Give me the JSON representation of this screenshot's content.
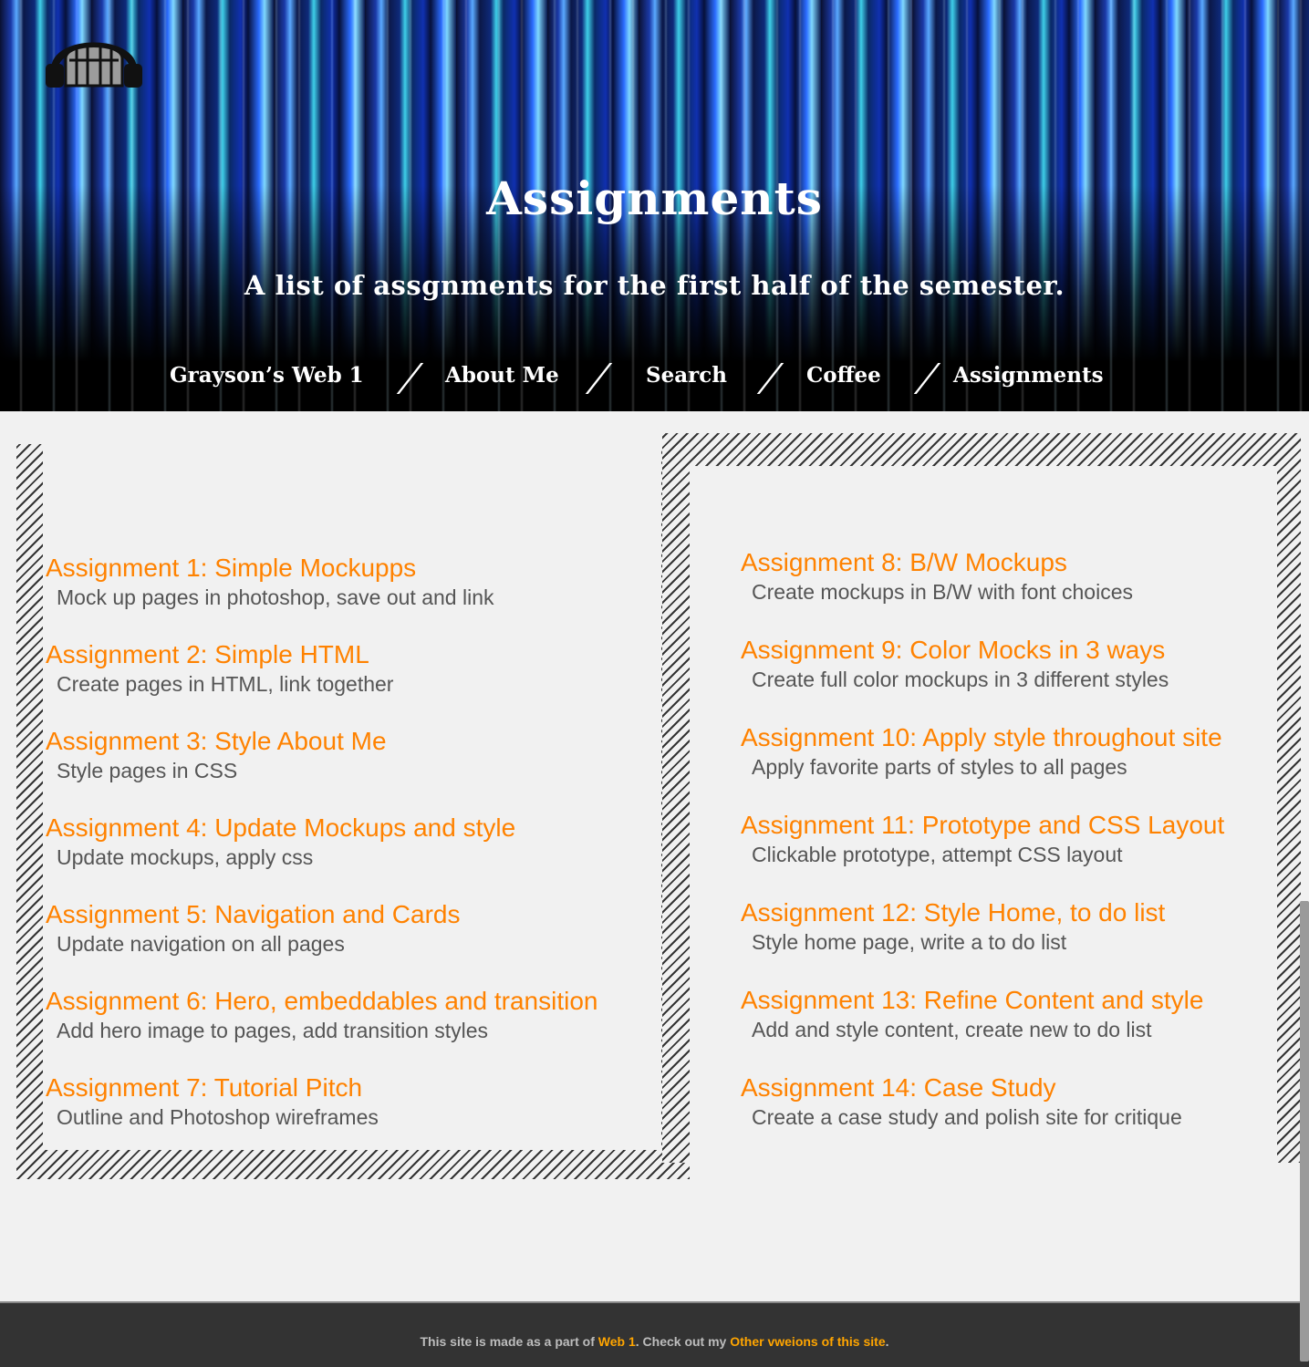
{
  "hero": {
    "title": "Assignments",
    "subtitle": "A list of assgnments for the first half of the semester."
  },
  "nav": {
    "items": [
      {
        "label": "Grayson’s Web 1"
      },
      {
        "label": "About Me"
      },
      {
        "label": "Search"
      },
      {
        "label": "Coffee"
      },
      {
        "label": "Assignments"
      }
    ]
  },
  "assignments_left": [
    {
      "title": "Assignment 1: Simple Mockupps",
      "desc": "Mock up pages in photoshop, save out and link"
    },
    {
      "title": "Assignment 2: Simple HTML",
      "desc": "Create pages in HTML, link together"
    },
    {
      "title": "Assignment 3: Style About Me",
      "desc": "Style pages in CSS"
    },
    {
      "title": "Assignment 4: Update Mockups and style",
      "desc": "Update mockups, apply css"
    },
    {
      "title": "Assignment 5: Navigation and Cards",
      "desc": "Update navigation on all pages"
    },
    {
      "title": "Assignment 6: Hero, embeddables and transition",
      "desc": "Add hero image to pages, add transition styles"
    },
    {
      "title": "Assignment 7: Tutorial Pitch",
      "desc": "Outline and Photoshop wireframes"
    }
  ],
  "assignments_right": [
    {
      "title": "Assignment 8: B/W Mockups",
      "desc": "Create mockups in B/W with font choices"
    },
    {
      "title": "Assignment 9: Color Mocks in 3 ways",
      "desc": "Create full color mockups in 3 different styles"
    },
    {
      "title": "Assignment 10: Apply style throughout site",
      "desc": "Apply favorite parts of styles to all pages"
    },
    {
      "title": "Assignment 11: Prototype and CSS Layout",
      "desc": "Clickable prototype, attempt CSS layout"
    },
    {
      "title": "Assignment 12: Style Home, to do list",
      "desc": "Style home page, write a to do list"
    },
    {
      "title": "Assignment 13: Refine Content and style",
      "desc": "Add and style content, create new to do list"
    },
    {
      "title": "Assignment 14: Case Study",
      "desc": "Create a case study and polish site for critique"
    }
  ],
  "footer": {
    "text_before": "This site is made as a part of ",
    "link1": "Web 1",
    "text_middle": ". Check out my ",
    "link2": "Other vweions of this site",
    "text_after": "."
  },
  "colors": {
    "accent": "#ff8200",
    "footer_link": "#ffa500",
    "footer_bg": "#333333",
    "page_bg": "#f1f1f1"
  },
  "icons": {
    "logo": "headphones-dome-icon"
  }
}
